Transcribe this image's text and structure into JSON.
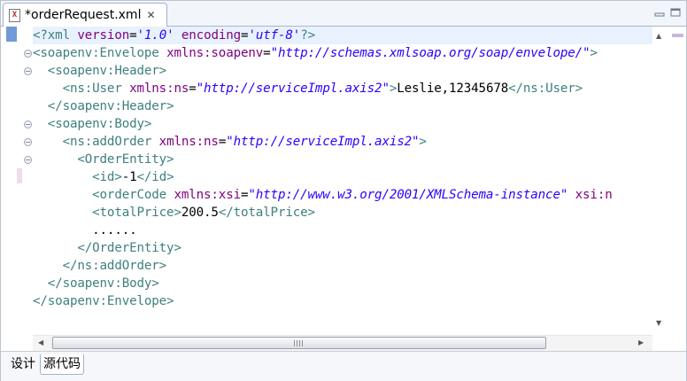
{
  "editor": {
    "tab_title": "*orderRequest.xml",
    "file_icon_glyph": "X",
    "close_glyph": "✕"
  },
  "code_lines": [
    {
      "tokens": [
        {
          "t": "<?xml ",
          "c": "tag"
        },
        {
          "t": "version",
          "c": "attr"
        },
        {
          "t": "=",
          "c": "txt"
        },
        {
          "t": "'1.0'",
          "c": "val"
        },
        {
          "t": " ",
          "c": "txt"
        },
        {
          "t": "encoding",
          "c": "attr"
        },
        {
          "t": "=",
          "c": "txt"
        },
        {
          "t": "'utf-8'",
          "c": "val"
        },
        {
          "t": "?>",
          "c": "tag"
        }
      ]
    },
    {
      "tokens": [
        {
          "t": "<soapenv:Envelope ",
          "c": "tag"
        },
        {
          "t": "xmlns:soapenv",
          "c": "attr"
        },
        {
          "t": "=",
          "c": "txt"
        },
        {
          "t": "\"http://schemas.xmlsoap.org/soap/envelope/\"",
          "c": "val"
        },
        {
          "t": ">",
          "c": "tag"
        }
      ]
    },
    {
      "tokens": [
        {
          "t": "  ",
          "c": "txt"
        },
        {
          "t": "<soapenv:Header>",
          "c": "tag"
        }
      ]
    },
    {
      "tokens": [
        {
          "t": "    ",
          "c": "txt"
        },
        {
          "t": "<ns:User ",
          "c": "tag"
        },
        {
          "t": "xmlns:ns",
          "c": "attr"
        },
        {
          "t": "=",
          "c": "txt"
        },
        {
          "t": "\"http://serviceImpl.axis2\"",
          "c": "val"
        },
        {
          "t": ">",
          "c": "tag"
        },
        {
          "t": "Leslie,12345678",
          "c": "txt"
        },
        {
          "t": "</ns:User>",
          "c": "tag"
        }
      ]
    },
    {
      "tokens": [
        {
          "t": "  ",
          "c": "txt"
        },
        {
          "t": "</soapenv:Header>",
          "c": "tag"
        }
      ]
    },
    {
      "tokens": [
        {
          "t": "  ",
          "c": "txt"
        },
        {
          "t": "<soapenv:Body>",
          "c": "tag"
        }
      ]
    },
    {
      "tokens": [
        {
          "t": "    ",
          "c": "txt"
        },
        {
          "t": "<ns:addOrder ",
          "c": "tag"
        },
        {
          "t": "xmlns:ns",
          "c": "attr"
        },
        {
          "t": "=",
          "c": "txt"
        },
        {
          "t": "\"http://serviceImpl.axis2\"",
          "c": "val"
        },
        {
          "t": ">",
          "c": "tag"
        }
      ]
    },
    {
      "tokens": [
        {
          "t": "      ",
          "c": "txt"
        },
        {
          "t": "<OrderEntity>",
          "c": "tag"
        }
      ]
    },
    {
      "tokens": [
        {
          "t": "        ",
          "c": "txt"
        },
        {
          "t": "<id>",
          "c": "tag"
        },
        {
          "t": "-1",
          "c": "txt"
        },
        {
          "t": "</id>",
          "c": "tag"
        }
      ]
    },
    {
      "tokens": [
        {
          "t": "        ",
          "c": "txt"
        },
        {
          "t": "<orderCode ",
          "c": "tag"
        },
        {
          "t": "xmlns:xsi",
          "c": "attr"
        },
        {
          "t": "=",
          "c": "txt"
        },
        {
          "t": "\"http://www.w3.org/2001/XMLSchema-instance\"",
          "c": "val"
        },
        {
          "t": " ",
          "c": "txt"
        },
        {
          "t": "xsi:n",
          "c": "attr"
        }
      ]
    },
    {
      "tokens": [
        {
          "t": "        ",
          "c": "txt"
        },
        {
          "t": "<totalPrice>",
          "c": "tag"
        },
        {
          "t": "200.5",
          "c": "txt"
        },
        {
          "t": "</totalPrice>",
          "c": "tag"
        }
      ]
    },
    {
      "tokens": [
        {
          "t": "        ",
          "c": "txt"
        },
        {
          "t": "......",
          "c": "txt"
        }
      ]
    },
    {
      "tokens": [
        {
          "t": "      ",
          "c": "txt"
        },
        {
          "t": "</OrderEntity>",
          "c": "tag"
        }
      ]
    },
    {
      "tokens": [
        {
          "t": "    ",
          "c": "txt"
        },
        {
          "t": "</ns:addOrder>",
          "c": "tag"
        }
      ]
    },
    {
      "tokens": [
        {
          "t": "  ",
          "c": "txt"
        },
        {
          "t": "</soapenv:Body>",
          "c": "tag"
        }
      ]
    },
    {
      "tokens": [
        {
          "t": "</soapenv:Envelope>",
          "c": "tag"
        }
      ]
    }
  ],
  "fold_glyph": "−",
  "bottom_tabs": [
    {
      "label": "设计",
      "active": false
    },
    {
      "label": "源代码",
      "active": true
    }
  ],
  "colors": {
    "tag": "#3f7f7f",
    "attribute": "#7f007f",
    "value": "#2a00ff",
    "current_line": "#e8f2fe",
    "ruler_mark": "#d8c7e8"
  }
}
